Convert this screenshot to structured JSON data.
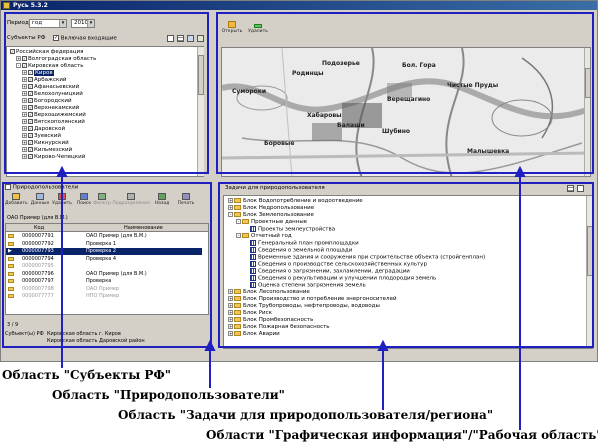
{
  "window": {
    "title": "Русь 5.3.2"
  },
  "subjects_panel": {
    "period_label": "Период",
    "period_value": "год",
    "year_value": "2010",
    "subjects_label": "Субъекты РФ",
    "include_nested_label": "Включая входящие",
    "tree": [
      {
        "level": 0,
        "expander": "",
        "label": "Российская федерация",
        "selected": false
      },
      {
        "level": 1,
        "expander": "+",
        "label": "Волгоградская область",
        "selected": false
      },
      {
        "level": 1,
        "expander": "-",
        "label": "Кировская область",
        "selected": false
      },
      {
        "level": 2,
        "expander": "+",
        "label": "Киров",
        "selected": true
      },
      {
        "level": 2,
        "expander": "+",
        "label": "Арбажский",
        "selected": false
      },
      {
        "level": 2,
        "expander": "+",
        "label": "Афанасьевский",
        "selected": false
      },
      {
        "level": 2,
        "expander": "+",
        "label": "Белохолуницкий",
        "selected": false
      },
      {
        "level": 2,
        "expander": "+",
        "label": "Богородский",
        "selected": false
      },
      {
        "level": 2,
        "expander": "+",
        "label": "Верхнекамский",
        "selected": false
      },
      {
        "level": 2,
        "expander": "+",
        "label": "Верхошижемский",
        "selected": false
      },
      {
        "level": 2,
        "expander": "+",
        "label": "Вятскополянский",
        "selected": false
      },
      {
        "level": 2,
        "expander": "+",
        "label": "Даровской",
        "selected": false
      },
      {
        "level": 2,
        "expander": "+",
        "label": "Зуевский",
        "selected": false
      },
      {
        "level": 2,
        "expander": "+",
        "label": "Кикнурский",
        "selected": false
      },
      {
        "level": 2,
        "expander": "+",
        "label": "Кильмезский",
        "selected": false
      },
      {
        "level": 2,
        "expander": "+",
        "label": "Кирово-Чепецкий",
        "selected": false
      }
    ]
  },
  "map_panel": {
    "toolbar": {
      "open_label": "Открыть",
      "delete_label": "Удалить"
    },
    "labels": [
      "Родинцы",
      "Подозерье",
      "Бол. Гора",
      "Сумороки",
      "Чистые Пруды",
      "Верещагино",
      "Хабаровы",
      "Балаши",
      "Шубино",
      "Боровые",
      "Малышевка"
    ]
  },
  "users_panel": {
    "title": "Природопользователи",
    "toolbar": [
      "Добавить",
      "Данные",
      "Удалить",
      "Поиск",
      "Фильтр",
      "Подразделения",
      "Назад",
      "Печать"
    ],
    "filter_text": "ОАО Пример (для В.М.)",
    "columns": [
      "Код",
      "Наименование"
    ],
    "rows": [
      {
        "code": "0000007791",
        "name": "ОАО Пример (для В.М.)",
        "state": "normal"
      },
      {
        "code": "0000007792",
        "name": "Проверка 1",
        "state": "normal"
      },
      {
        "code": "0000007793",
        "name": "Проверка 2",
        "state": "selected"
      },
      {
        "code": "0000007794",
        "name": "Проверка 4",
        "state": "normal"
      },
      {
        "code": "0000007795",
        "name": "",
        "state": "muted"
      },
      {
        "code": "0000007796",
        "name": "ОАО Пример (для В.М.)",
        "state": "normal"
      },
      {
        "code": "0000007797",
        "name": "Проверка",
        "state": "normal"
      },
      {
        "code": "0000007798",
        "name": "ОАО Пример",
        "state": "muted"
      },
      {
        "code": "0000077777",
        "name": "НПО Пример",
        "state": "muted"
      }
    ],
    "page_info": "3 / 9",
    "subject_label": "Субъект(ы) РФ",
    "subject_lines": [
      "Кировская область г. Киров",
      "Кировская область Даровской район"
    ]
  },
  "tasks_panel": {
    "title": "Задачи для природопользователя",
    "tree": [
      {
        "level": 0,
        "kind": "folder",
        "expander": "+",
        "label": "Блок Водопотребление и водоотведение"
      },
      {
        "level": 0,
        "kind": "folder",
        "expander": "+",
        "label": "Блок Недропользование"
      },
      {
        "level": 0,
        "kind": "folder",
        "expander": "-",
        "label": "Блок Землепользование"
      },
      {
        "level": 1,
        "kind": "folder",
        "expander": "-",
        "label": "Проектные данные"
      },
      {
        "level": 2,
        "kind": "grid",
        "expander": "",
        "label": "Проекты землеустройства"
      },
      {
        "level": 1,
        "kind": "folder",
        "expander": "-",
        "label": "Отчетный год"
      },
      {
        "level": 2,
        "kind": "grid",
        "expander": "",
        "label": "Генеральный план промплощадки"
      },
      {
        "level": 2,
        "kind": "grid",
        "expander": "",
        "label": "Сведения о земельной площади"
      },
      {
        "level": 2,
        "kind": "grid",
        "expander": "",
        "label": "Временные здания и сооружения при строительстве объекта (стройгенплан)"
      },
      {
        "level": 2,
        "kind": "grid",
        "expander": "",
        "label": "Сведения о производстве сельскохозяйственных культур"
      },
      {
        "level": 2,
        "kind": "grid",
        "expander": "",
        "label": "Сведения о загрязнении, захламлении, деградации"
      },
      {
        "level": 2,
        "kind": "grid",
        "expander": "",
        "label": "Сведения о рекультивации и улучшении плодородия земель"
      },
      {
        "level": 2,
        "kind": "grid",
        "expander": "",
        "label": "Оценка степени загрязнения земель"
      },
      {
        "level": 0,
        "kind": "folder",
        "expander": "+",
        "label": "Блок Лесопользование"
      },
      {
        "level": 0,
        "kind": "folder",
        "expander": "+",
        "label": "Блок Производство и потребление энергоносителей"
      },
      {
        "level": 0,
        "kind": "folder",
        "expander": "+",
        "label": "Блок Трубопроводы, нефтепроводы, водоводы"
      },
      {
        "level": 0,
        "kind": "folder",
        "expander": "+",
        "label": "Блок Риск"
      },
      {
        "level": 0,
        "kind": "folder",
        "expander": "+",
        "label": "Блок Промбезопасность"
      },
      {
        "level": 0,
        "kind": "folder",
        "expander": "+",
        "label": "Блок Пожарная безопасность"
      },
      {
        "level": 0,
        "kind": "folder",
        "expander": "+",
        "label": "Блок Аварии"
      }
    ]
  },
  "captions": {
    "subjects": "Область \"Субъекты РФ\"",
    "users": "Область \"Природопользователи\"",
    "tasks": "Область \"Задачи для природопользователя/региона\"",
    "graphics": "Области \"Графическая информация\"/\"Рабочая область\""
  },
  "colors": {
    "frame": "#2020c0",
    "selection": "#0a246a",
    "window_bg": "#d4d0c8"
  }
}
